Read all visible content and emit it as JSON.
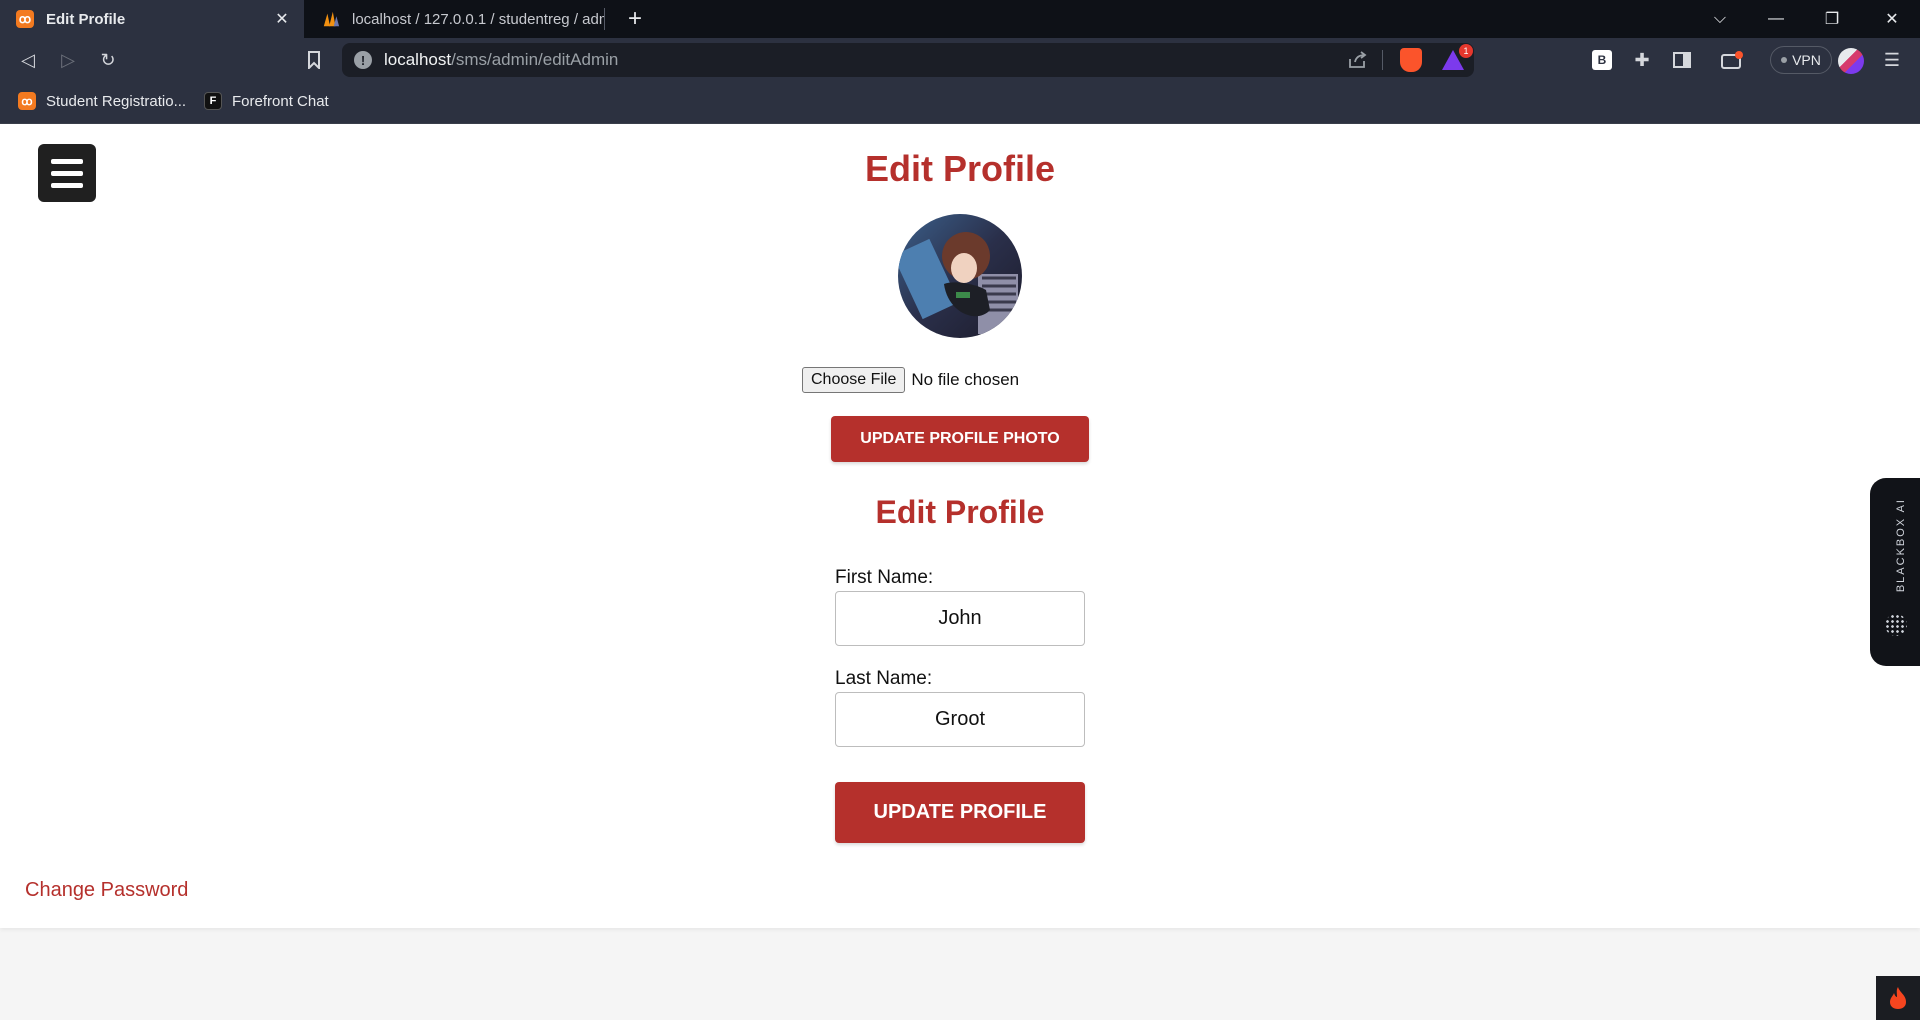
{
  "browser": {
    "tabs": [
      {
        "title": "Edit Profile",
        "active": true,
        "favicon": "xampp-icon"
      },
      {
        "title": "localhost / 127.0.0.1 / studentreg / adm",
        "active": false,
        "favicon": "phpmyadmin-icon"
      }
    ],
    "url": {
      "host": "localhost",
      "path": "/sms/admin/editAdmin"
    },
    "vpn_label": "VPN",
    "rewards_badge": "1",
    "extension_b_label": "B",
    "bookmarks": [
      {
        "label": "Student Registratio...",
        "favicon": "xampp-icon"
      },
      {
        "label": "Forefront Chat",
        "favicon": "forefront-icon"
      }
    ]
  },
  "page": {
    "title": "Edit Profile",
    "file_input": {
      "button_label": "Choose File",
      "status": "No file chosen"
    },
    "update_photo_label": "UPDATE PROFILE PHOTO",
    "form_title": "Edit Profile",
    "first_name": {
      "label": "First Name:",
      "value": "John"
    },
    "last_name": {
      "label": "Last Name:",
      "value": "Groot"
    },
    "update_profile_label": "UPDATE PROFILE",
    "change_password_label": "Change Password"
  },
  "sidebar_widget": {
    "label": "BLACKBOX AI"
  },
  "colors": {
    "accent": "#b5302c",
    "chrome": "#2c3140",
    "tabbar": "#0e1117"
  }
}
